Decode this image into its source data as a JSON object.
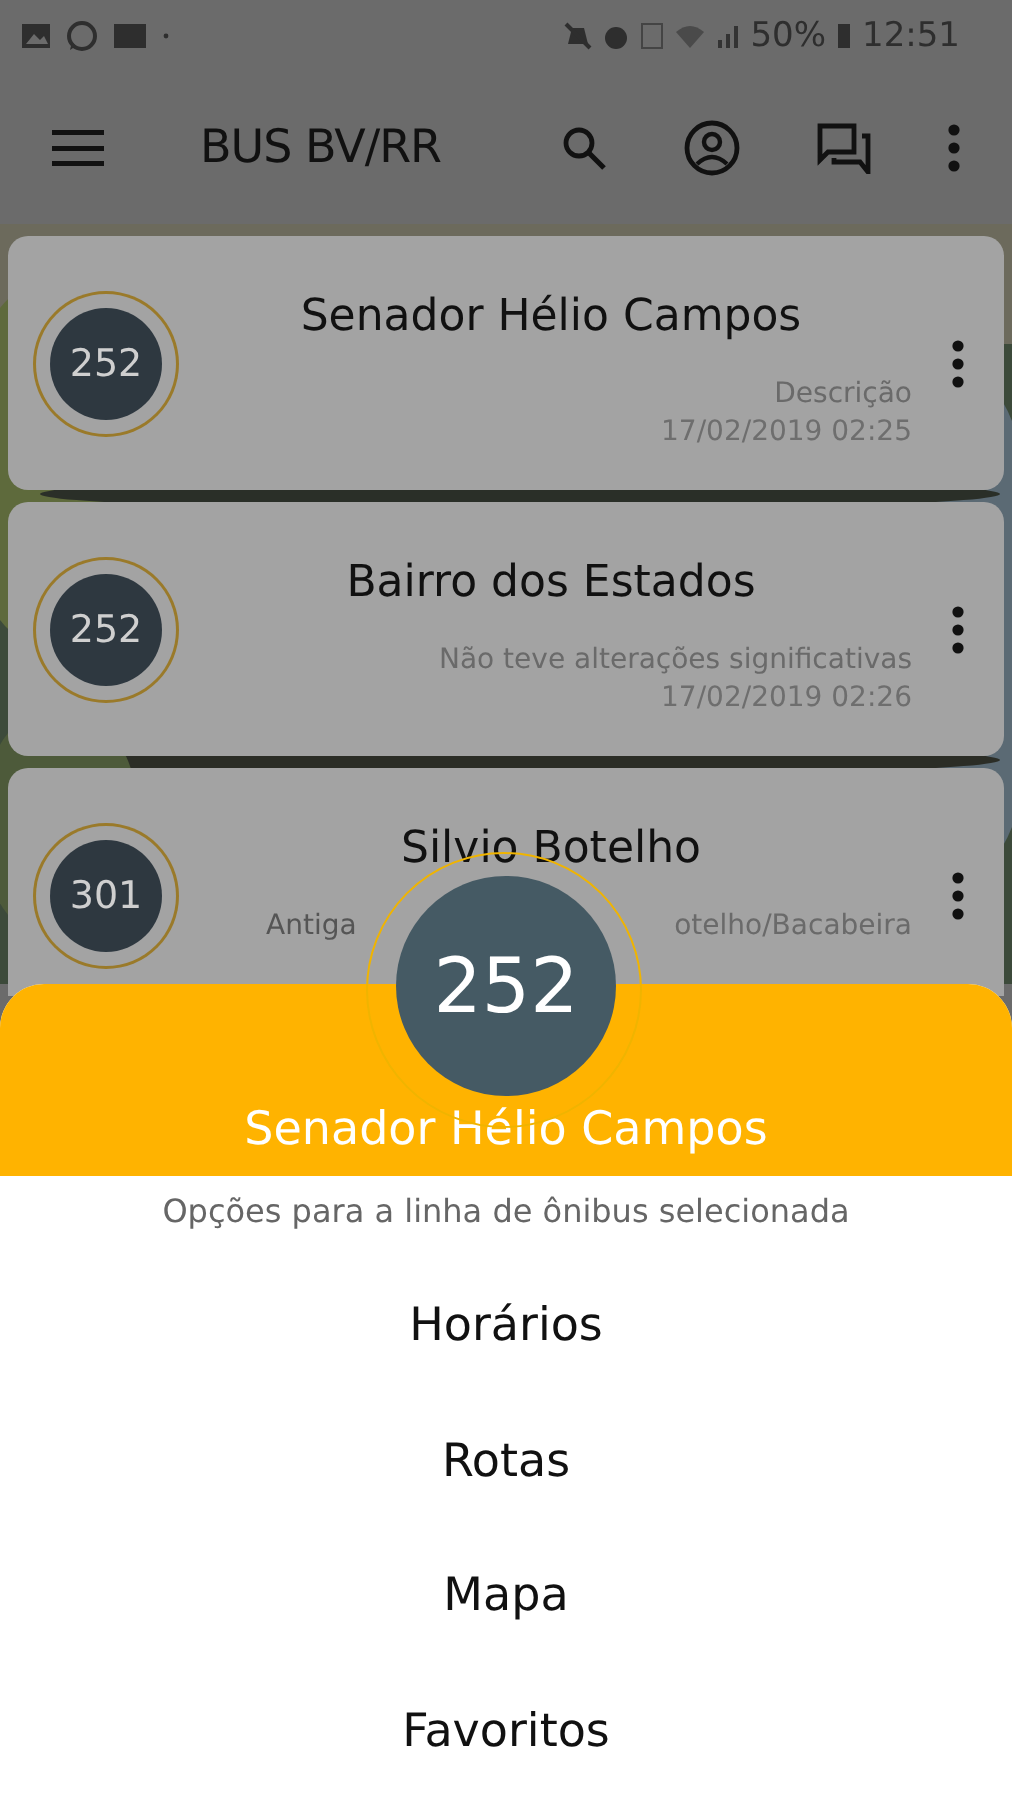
{
  "status_bar": {
    "time": "12:51",
    "battery_text": "50%"
  },
  "toolbar": {
    "title": "BUS BV/RR"
  },
  "cards": [
    {
      "number": "252",
      "title": "Senador Hélio Campos",
      "description": [
        "Descrição"
      ],
      "date": "17/02/2019 02:25"
    },
    {
      "number": "252",
      "title": "Bairro dos Estados",
      "description": [
        "Não teve alterações significativas"
      ],
      "date": "17/02/2019 02:26"
    },
    {
      "number": "301",
      "title": "Silvio Botelho",
      "description": [
        "Antiga",
        "otelho/Bacabeira"
      ]
    }
  ],
  "sheet": {
    "number": "252",
    "title": "Senador Hélio Campos",
    "subtitle": "Opções para a linha de ônibus selecionada",
    "options": [
      "Horários",
      "Rotas",
      "Mapa",
      "Favoritos"
    ]
  }
}
